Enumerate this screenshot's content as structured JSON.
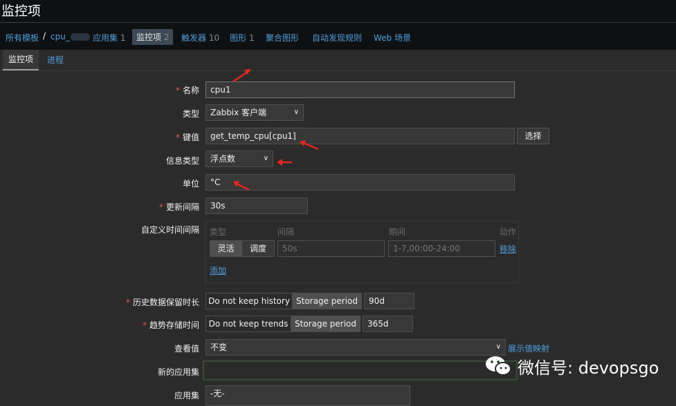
{
  "page_title": "监控项",
  "nav": {
    "all_templates": "所有模板",
    "template_name": "cpu_",
    "apps_label": "应用集",
    "apps_count": "1",
    "items_label": "监控项",
    "items_count": "2",
    "triggers_label": "触发器",
    "triggers_count": "10",
    "graphs_label": "图形",
    "graphs_count": "1",
    "screens_label": "聚合图形",
    "discovery_label": "自动发现规则",
    "web_label": "Web 场景"
  },
  "tabs": {
    "item": "监控项",
    "process": "进程"
  },
  "form": {
    "name_label": "名称",
    "name_value": "cpu1",
    "type_label": "类型",
    "type_value": "Zabbix 客户端",
    "key_label": "键值",
    "key_value": "get_temp_cpu[cpu1]",
    "select_button": "选择",
    "info_type_label": "信息类型",
    "info_type_value": "浮点数",
    "units_label": "单位",
    "units_value": "°C",
    "interval_label": "更新间隔",
    "interval_value": "30s",
    "custom_label": "自定义时间间隔",
    "custom": {
      "col_type": "类型",
      "col_interval": "间隔",
      "col_period": "期间",
      "col_action": "动作",
      "flexible": "灵活",
      "scheduling": "调度",
      "interval_placeholder": "50s",
      "period_placeholder": "1-7,00:00-24:00",
      "remove": "移除",
      "add": "添加"
    },
    "history_label": "历史数据保留时长",
    "history_no_keep": "Do not keep history",
    "history_storage": "Storage period",
    "history_value": "90d",
    "trends_label": "趋势存储时间",
    "trends_no_keep": "Do not keep trends",
    "trends_storage": "Storage period",
    "trends_value": "365d",
    "showvalue_label": "查看值",
    "showvalue_value": "不变",
    "showvalue_link": "展示值映射",
    "new_app_label": "新的应用集",
    "new_app_value": "",
    "apps_label": "应用集",
    "apps_value": "-无-"
  },
  "watermark": "微信号: devopsgo",
  "colors": {
    "link": "#4f9fde",
    "required": "#e45959",
    "arrow": "#e8261c"
  }
}
